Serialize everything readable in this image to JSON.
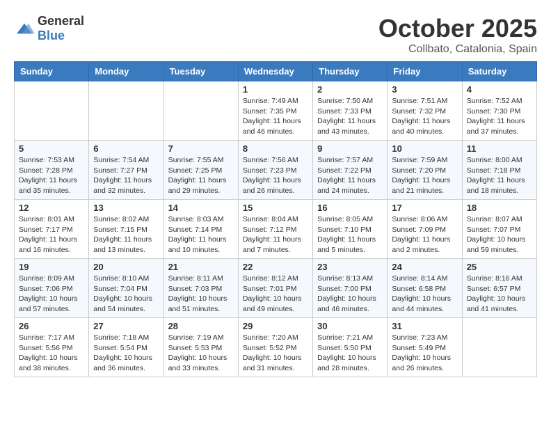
{
  "header": {
    "logo_general": "General",
    "logo_blue": "Blue",
    "month_title": "October 2025",
    "location": "Collbato, Catalonia, Spain"
  },
  "days_of_week": [
    "Sunday",
    "Monday",
    "Tuesday",
    "Wednesday",
    "Thursday",
    "Friday",
    "Saturday"
  ],
  "weeks": [
    [
      {
        "day": "",
        "info": ""
      },
      {
        "day": "",
        "info": ""
      },
      {
        "day": "",
        "info": ""
      },
      {
        "day": "1",
        "info": "Sunrise: 7:49 AM\nSunset: 7:35 PM\nDaylight: 11 hours\nand 46 minutes."
      },
      {
        "day": "2",
        "info": "Sunrise: 7:50 AM\nSunset: 7:33 PM\nDaylight: 11 hours\nand 43 minutes."
      },
      {
        "day": "3",
        "info": "Sunrise: 7:51 AM\nSunset: 7:32 PM\nDaylight: 11 hours\nand 40 minutes."
      },
      {
        "day": "4",
        "info": "Sunrise: 7:52 AM\nSunset: 7:30 PM\nDaylight: 11 hours\nand 37 minutes."
      }
    ],
    [
      {
        "day": "5",
        "info": "Sunrise: 7:53 AM\nSunset: 7:28 PM\nDaylight: 11 hours\nand 35 minutes."
      },
      {
        "day": "6",
        "info": "Sunrise: 7:54 AM\nSunset: 7:27 PM\nDaylight: 11 hours\nand 32 minutes."
      },
      {
        "day": "7",
        "info": "Sunrise: 7:55 AM\nSunset: 7:25 PM\nDaylight: 11 hours\nand 29 minutes."
      },
      {
        "day": "8",
        "info": "Sunrise: 7:56 AM\nSunset: 7:23 PM\nDaylight: 11 hours\nand 26 minutes."
      },
      {
        "day": "9",
        "info": "Sunrise: 7:57 AM\nSunset: 7:22 PM\nDaylight: 11 hours\nand 24 minutes."
      },
      {
        "day": "10",
        "info": "Sunrise: 7:59 AM\nSunset: 7:20 PM\nDaylight: 11 hours\nand 21 minutes."
      },
      {
        "day": "11",
        "info": "Sunrise: 8:00 AM\nSunset: 7:18 PM\nDaylight: 11 hours\nand 18 minutes."
      }
    ],
    [
      {
        "day": "12",
        "info": "Sunrise: 8:01 AM\nSunset: 7:17 PM\nDaylight: 11 hours\nand 16 minutes."
      },
      {
        "day": "13",
        "info": "Sunrise: 8:02 AM\nSunset: 7:15 PM\nDaylight: 11 hours\nand 13 minutes."
      },
      {
        "day": "14",
        "info": "Sunrise: 8:03 AM\nSunset: 7:14 PM\nDaylight: 11 hours\nand 10 minutes."
      },
      {
        "day": "15",
        "info": "Sunrise: 8:04 AM\nSunset: 7:12 PM\nDaylight: 11 hours\nand 7 minutes."
      },
      {
        "day": "16",
        "info": "Sunrise: 8:05 AM\nSunset: 7:10 PM\nDaylight: 11 hours\nand 5 minutes."
      },
      {
        "day": "17",
        "info": "Sunrise: 8:06 AM\nSunset: 7:09 PM\nDaylight: 11 hours\nand 2 minutes."
      },
      {
        "day": "18",
        "info": "Sunrise: 8:07 AM\nSunset: 7:07 PM\nDaylight: 10 hours\nand 59 minutes."
      }
    ],
    [
      {
        "day": "19",
        "info": "Sunrise: 8:09 AM\nSunset: 7:06 PM\nDaylight: 10 hours\nand 57 minutes."
      },
      {
        "day": "20",
        "info": "Sunrise: 8:10 AM\nSunset: 7:04 PM\nDaylight: 10 hours\nand 54 minutes."
      },
      {
        "day": "21",
        "info": "Sunrise: 8:11 AM\nSunset: 7:03 PM\nDaylight: 10 hours\nand 51 minutes."
      },
      {
        "day": "22",
        "info": "Sunrise: 8:12 AM\nSunset: 7:01 PM\nDaylight: 10 hours\nand 49 minutes."
      },
      {
        "day": "23",
        "info": "Sunrise: 8:13 AM\nSunset: 7:00 PM\nDaylight: 10 hours\nand 46 minutes."
      },
      {
        "day": "24",
        "info": "Sunrise: 8:14 AM\nSunset: 6:58 PM\nDaylight: 10 hours\nand 44 minutes."
      },
      {
        "day": "25",
        "info": "Sunrise: 8:16 AM\nSunset: 6:57 PM\nDaylight: 10 hours\nand 41 minutes."
      }
    ],
    [
      {
        "day": "26",
        "info": "Sunrise: 7:17 AM\nSunset: 5:56 PM\nDaylight: 10 hours\nand 38 minutes."
      },
      {
        "day": "27",
        "info": "Sunrise: 7:18 AM\nSunset: 5:54 PM\nDaylight: 10 hours\nand 36 minutes."
      },
      {
        "day": "28",
        "info": "Sunrise: 7:19 AM\nSunset: 5:53 PM\nDaylight: 10 hours\nand 33 minutes."
      },
      {
        "day": "29",
        "info": "Sunrise: 7:20 AM\nSunset: 5:52 PM\nDaylight: 10 hours\nand 31 minutes."
      },
      {
        "day": "30",
        "info": "Sunrise: 7:21 AM\nSunset: 5:50 PM\nDaylight: 10 hours\nand 28 minutes."
      },
      {
        "day": "31",
        "info": "Sunrise: 7:23 AM\nSunset: 5:49 PM\nDaylight: 10 hours\nand 26 minutes."
      },
      {
        "day": "",
        "info": ""
      }
    ]
  ]
}
